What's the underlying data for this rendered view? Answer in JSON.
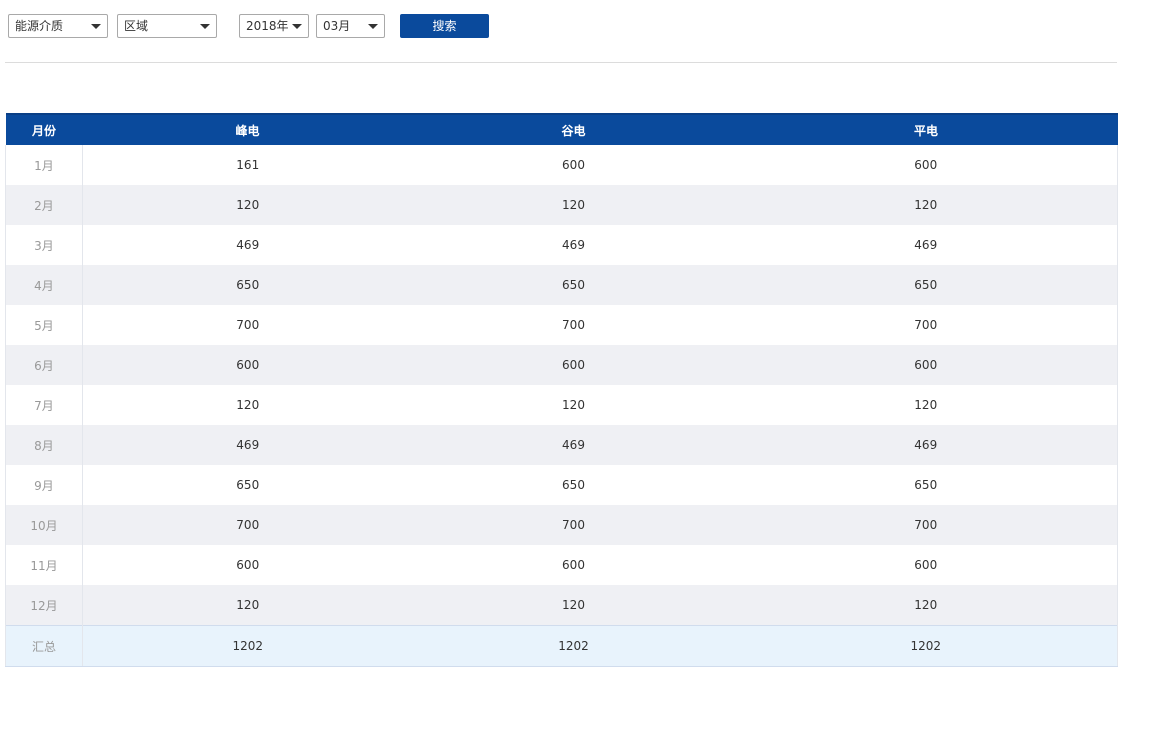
{
  "filters": {
    "medium": {
      "value": "能源介质"
    },
    "region": {
      "value": "区域"
    },
    "year": {
      "value": "2018年"
    },
    "month": {
      "value": "03月"
    },
    "search_label": "搜索"
  },
  "table": {
    "headers": [
      "月份",
      "峰电",
      "谷电",
      "平电"
    ],
    "rows": [
      [
        "1月",
        "161",
        "600",
        "600"
      ],
      [
        "2月",
        "120",
        "120",
        "120"
      ],
      [
        "3月",
        "469",
        "469",
        "469"
      ],
      [
        "4月",
        "650",
        "650",
        "650"
      ],
      [
        "5月",
        "700",
        "700",
        "700"
      ],
      [
        "6月",
        "600",
        "600",
        "600"
      ],
      [
        "7月",
        "120",
        "120",
        "120"
      ],
      [
        "8月",
        "469",
        "469",
        "469"
      ],
      [
        "9月",
        "650",
        "650",
        "650"
      ],
      [
        "10月",
        "700",
        "700",
        "700"
      ],
      [
        "11月",
        "600",
        "600",
        "600"
      ],
      [
        "12月",
        "120",
        "120",
        "120"
      ]
    ],
    "total": [
      "汇总",
      "1202",
      "1202",
      "1202"
    ]
  },
  "colors": {
    "header_bg": "#0a4a9c",
    "button_bg": "#0a4a9c",
    "row_alt_bg": "#eff0f4",
    "total_row_bg": "#e8f3fc"
  }
}
